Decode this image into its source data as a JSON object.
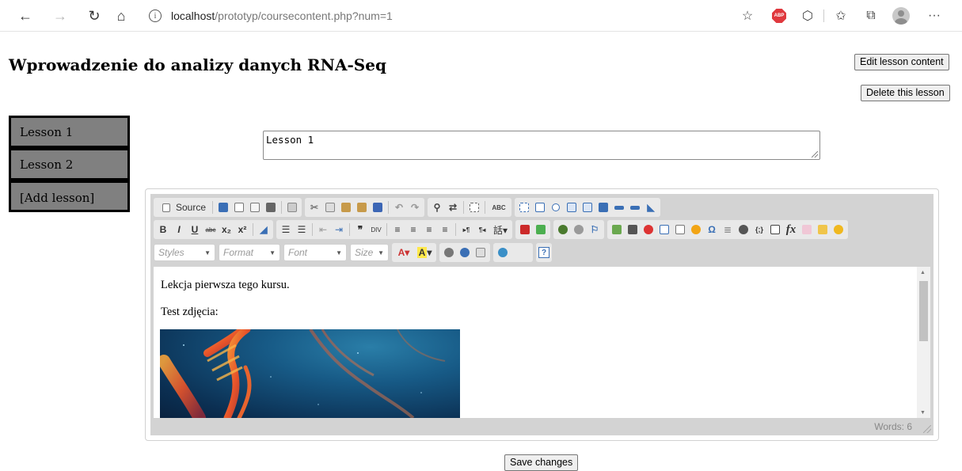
{
  "browser": {
    "url_host": "localhost",
    "url_path": "/prototyp/coursecontent.php?num=1",
    "adblock_label": "ABP"
  },
  "page": {
    "title": "Wprowadzenie do analizy danych RNA-Seq",
    "edit_button": "Edit lesson content",
    "delete_button": "Delete this lesson",
    "save_button": "Save changes"
  },
  "sidebar": {
    "items": [
      {
        "label": "Lesson 1"
      },
      {
        "label": "Lesson 2"
      },
      {
        "label": "[Add lesson]"
      }
    ]
  },
  "lesson_title_input": {
    "value": "Lesson 1"
  },
  "editor": {
    "source_label": "Source",
    "combos": {
      "styles": "Styles",
      "format": "Format",
      "font": "Font",
      "size": "Size"
    },
    "content": {
      "paragraph1": "Lekcja pierwsza tego kursu.",
      "paragraph2": "Test zdjęcia:"
    },
    "word_count": "Words: 6",
    "toolbar_glyphs": {
      "bold": "B",
      "italic": "I",
      "underline": "U",
      "strike": "abc",
      "subscript": "x₂",
      "superscript": "x²",
      "omega": "Ω",
      "fx": "fx",
      "spellcheck": "ABC",
      "help": "?"
    }
  },
  "colors": {
    "sidebar_bg": "#808080",
    "editor_toolbar_bg": "#d3d3d3",
    "button_bg": "#efefef"
  }
}
